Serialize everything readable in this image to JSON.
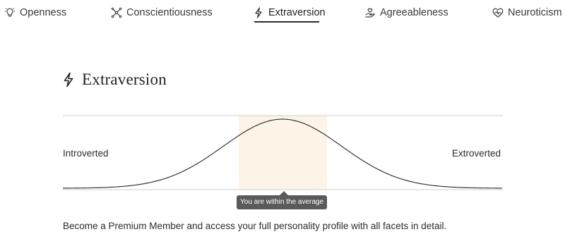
{
  "tabs": [
    {
      "label": "Openness",
      "icon": "lightbulb-icon",
      "active": false
    },
    {
      "label": "Conscientiousness",
      "icon": "network-icon",
      "active": false
    },
    {
      "label": "Extraversion",
      "icon": "lightning-icon",
      "active": true
    },
    {
      "label": "Agreeableness",
      "icon": "hand-heart-icon",
      "active": false
    },
    {
      "label": "Neuroticism",
      "icon": "heart-pulse-icon",
      "active": false
    }
  ],
  "section": {
    "title": "Extraversion",
    "icon": "lightning-icon"
  },
  "scale": {
    "left_label": "Introverted",
    "right_label": "Extroverted",
    "result": "within-average",
    "tooltip": "You are within the average"
  },
  "cta": {
    "text": "Become a Premium Member and access your full personality profile with all facets in detail."
  },
  "colors": {
    "highlight": "#fdf3e6",
    "curve": "#2e3a3a",
    "line": "#cfcfcf",
    "tooltip_bg": "#5a5a5a"
  }
}
